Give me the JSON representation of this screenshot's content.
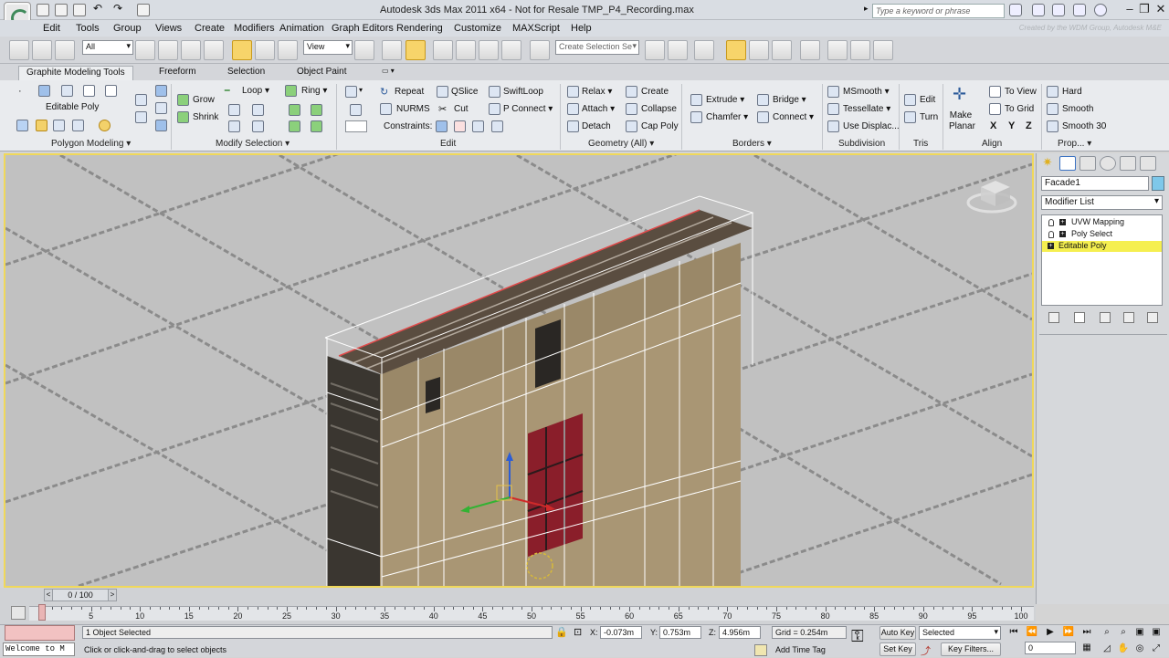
{
  "window": {
    "title": "Autodesk 3ds Max  2011 x64    -  Not for Resale    TMP_P4_Recording.max",
    "search_placeholder": "Type a keyword or phrase",
    "credit": "Created by the WDM Group, Autodesk M&E"
  },
  "menu": [
    "Edit",
    "Tools",
    "Group",
    "Views",
    "Create",
    "Modifiers",
    "Animation",
    "Graph Editors",
    "Rendering",
    "Customize",
    "MAXScript",
    "Help"
  ],
  "toolbar": {
    "selection_filter": "All",
    "reference_coord": "View",
    "named_selection_placeholder": "Create Selection Se"
  },
  "ribbon_tabs": [
    "Graphite Modeling Tools",
    "Freeform",
    "Selection",
    "Object Paint"
  ],
  "ribbon": {
    "polygon_modeling": {
      "object_label": "Editable Poly",
      "section": "Polygon Modeling"
    },
    "modify_selection": {
      "grow": "Grow",
      "shrink": "Shrink",
      "loop": "Loop",
      "ring": "Ring",
      "section": "Modify Selection"
    },
    "edit": {
      "repeat": "Repeat",
      "qslice": "QSlice",
      "swiftloop": "SwiftLoop",
      "nurms": "NURMS",
      "cut": "Cut",
      "pconnect": "P Connect",
      "constraints": "Constraints:",
      "section": "Edit"
    },
    "geometry": {
      "relax": "Relax",
      "create": "Create",
      "attach": "Attach",
      "collapse": "Collapse",
      "detach": "Detach",
      "cap_poly": "Cap Poly",
      "section": "Geometry (All)"
    },
    "borders": {
      "extrude": "Extrude",
      "bridge": "Bridge",
      "chamfer": "Chamfer",
      "connect": "Connect",
      "section": "Borders"
    },
    "subdivision": {
      "msmooth": "MSmooth",
      "tessellate": "Tessellate",
      "use_displac": "Use Displac...",
      "section": "Subdivision"
    },
    "tris": {
      "edit": "Edit",
      "turn": "Turn",
      "section": "Tris"
    },
    "align": {
      "make_planar": "Make Planar",
      "to_view": "To View",
      "to_grid": "To Grid",
      "x": "X",
      "y": "Y",
      "z": "Z",
      "section": "Align"
    },
    "properties": {
      "hard": "Hard",
      "smooth": "Smooth",
      "smooth30": "Smooth 30",
      "section": "Prop..."
    }
  },
  "command_panel": {
    "object_name": "Facade1",
    "modifier_list": "Modifier List",
    "stack": [
      "UVW Mapping",
      "Poly Select",
      "Editable Poly"
    ],
    "selected_stack_index": 2
  },
  "timeline": {
    "frame_counter": "0 / 100",
    "ticks": [
      0,
      5,
      10,
      15,
      20,
      25,
      30,
      35,
      40,
      45,
      50,
      55,
      60,
      65,
      70,
      75,
      80,
      85,
      90,
      95,
      100
    ],
    "start": 0,
    "end": 100,
    "current": 0
  },
  "status": {
    "listener": "Welcome to M",
    "selection": "1 Object Selected",
    "prompt": "Click or click-and-drag to select objects",
    "x_label": "X:",
    "x": "-0.073m",
    "y_label": "Y:",
    "y": "0.753m",
    "z_label": "Z:",
    "z": "4.956m",
    "grid": "Grid = 0.254m",
    "add_time_tag": "Add Time Tag",
    "auto_key": "Auto Key",
    "set_key": "Set Key",
    "key_mode": "Selected",
    "key_filters": "Key Filters...",
    "frame_field": "0"
  },
  "colors": {
    "viewport_border": "#f0d85a",
    "selected_stack": "#f5ef50",
    "wireframe": "#ffffff"
  }
}
